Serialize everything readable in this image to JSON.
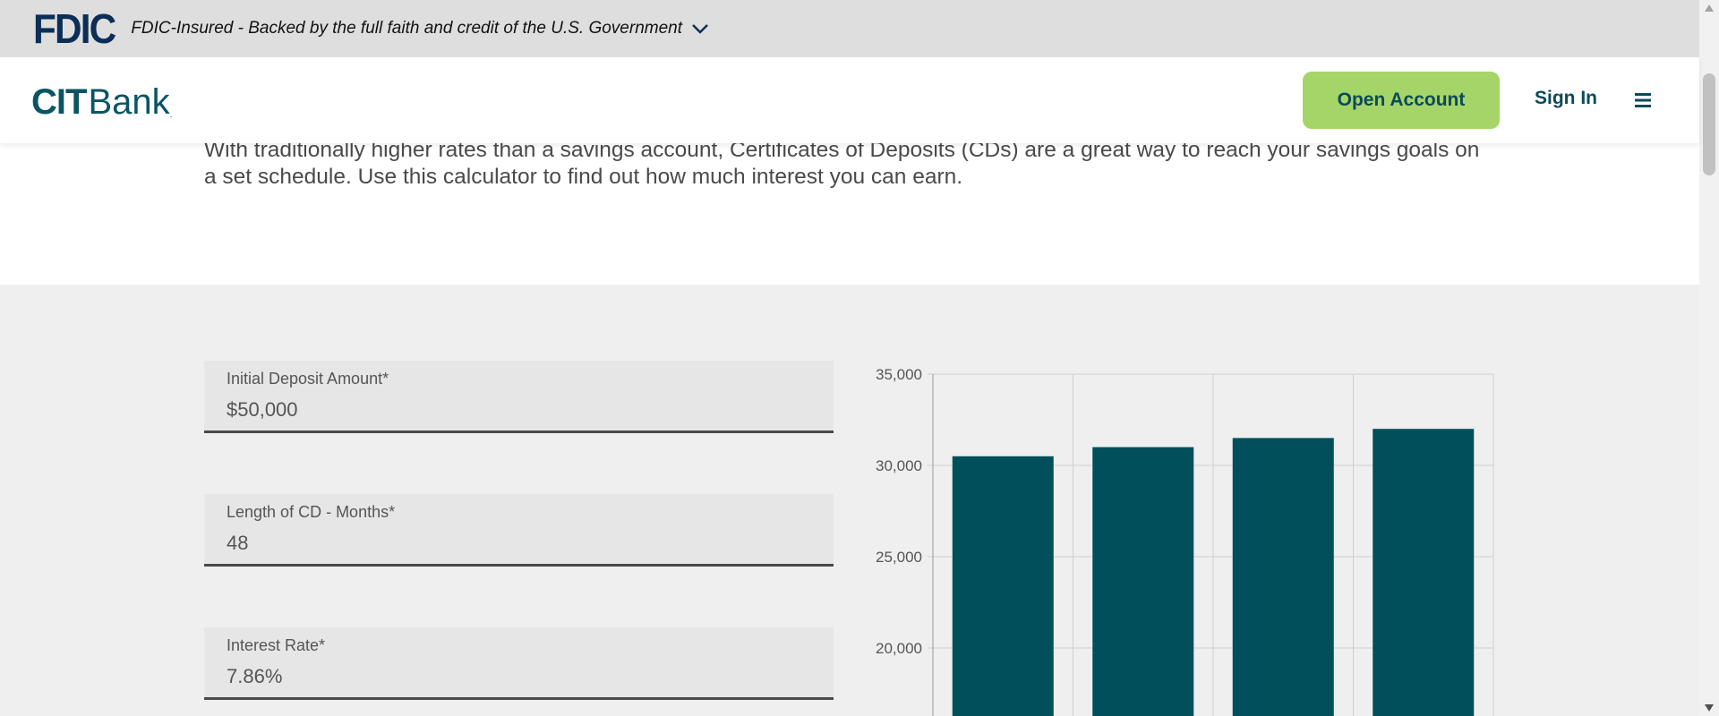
{
  "fdic_bar": {
    "logo": "FDIC",
    "text": "FDIC-Insured - Backed by the full faith and credit of the U.S. Government",
    "chevron_icon": "chevron-down-icon"
  },
  "header": {
    "logo_cit": "CIT",
    "logo_bank": "Bank",
    "logo_reg": ".",
    "open_account_label": "Open Account",
    "sign_in_label": "Sign In",
    "menu_icon": "hamburger-menu-icon",
    "accent_color": "#a5d568",
    "brand_color": "#0b5563"
  },
  "intro": {
    "text": "With traditionally higher rates than a savings account, Certificates of Deposits (CDs) are a great way to reach your savings goals on a set schedule. Use this calculator to find out how much interest you can earn."
  },
  "form": {
    "initial_deposit": {
      "label": "Initial Deposit Amount*",
      "value": "$50,000"
    },
    "length": {
      "label": "Length of CD - Months*",
      "value": "48"
    },
    "rate": {
      "label": "Interest Rate*",
      "value": "7.86%"
    }
  },
  "chart_data": {
    "type": "bar",
    "title": "",
    "xlabel": "",
    "ylabel": "",
    "ylim": [
      0,
      35000
    ],
    "visible_ylim": [
      16000,
      35000
    ],
    "yticks": [
      "35,000",
      "30,000",
      "25,000",
      "20,000"
    ],
    "ytick_values": [
      35000,
      30000,
      25000,
      20000
    ],
    "values": [
      30500,
      31000,
      31500,
      32000
    ],
    "bar_color": "#004f5b",
    "grid": true
  }
}
